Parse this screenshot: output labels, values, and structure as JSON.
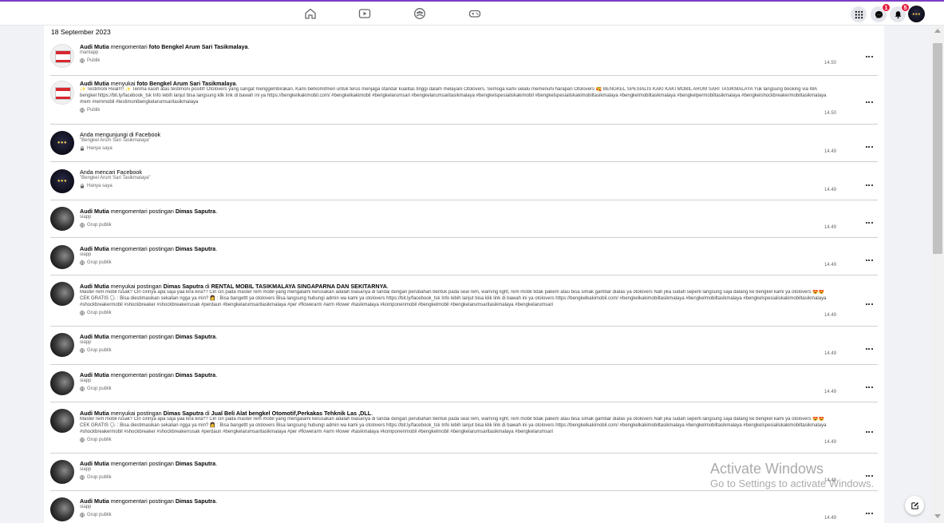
{
  "topbar": {
    "nav_icons": [
      "home-icon",
      "watch-icon",
      "groups-icon",
      "gaming-icon"
    ],
    "right_icons": [
      "menu-grid-icon",
      "messenger-icon",
      "notifications-icon",
      "profile-avatar"
    ],
    "messenger_badge": "1",
    "notifications_badge": "5",
    "accent_color": "#7b3fc4",
    "badge_color": "#e41e3f"
  },
  "log": {
    "date_heading": "18 September 2023",
    "entries": [
      {
        "actor": "Audi Mutia",
        "action": " mengomentari ",
        "target": "foto Bengkel Arum Sari Tasikmalaya",
        "suffix": ".",
        "detail": "mantapp",
        "privacy": "Publik",
        "privacy_icon": "globe-icon",
        "time": "14.50",
        "thumb": "bengkel"
      },
      {
        "actor": "Audi Mutia",
        "action": " menyukai ",
        "target": "foto Bengkel Arum Sari Tasikmalaya",
        "suffix": ".",
        "detail": "✨ Testimoni Real!!!! ✨ Terima kasih atas testimoni positif! Otolovers yang sangat menggembirakan. Kami berkomitmen untuk terus menjaga standar kualitas tinggi dalam melayani Otolovers. Semoga kami selalu memenuhi harapan Otolovers 🥰 BENGKEL SPESIALIS KAKI KAKI MOBIL ARUM SARI TASIKMALAYA Yuk langsung booking via WA bengkel https://bit.ly/facebook_tsk Info lebih lanjut bisa langsung klik link di bawah ini ya https://bengkelkakimobil.com/ #bengkelkakimobil #bengkelarumsari #bengkelarumsaritasikmalaya #bengkelspesialiskakimobil #bengkelspesialiskakimobiltasikmalaya #bengkelmobiltasikmalaya #bengkelpermobiltasikmalaya #bengkelshockbreakermobiltasikmalaya #rem #remmobil #testimonibengkelarumsaritasikmalaya",
        "privacy": "Publik",
        "privacy_icon": "globe-icon",
        "time": "14.50",
        "thumb": "bengkel"
      },
      {
        "actor": "",
        "action": "Anda mengunjungi di Facebook",
        "target": "",
        "suffix": "",
        "detail": "\"Bengkel Arum Sari Tasikmalaya\"",
        "privacy": "Hanya saya",
        "privacy_icon": "lock-icon",
        "time": "14.49",
        "thumb": "dark"
      },
      {
        "actor": "",
        "action": "Anda mencari Facebook",
        "target": "",
        "suffix": "",
        "detail": "\"Bengkel Arum Sari Tasikmalaya\"",
        "privacy": "Hanya saya",
        "privacy_icon": "lock-icon",
        "time": "14.49",
        "thumb": "dark"
      },
      {
        "actor": "Audi Mutia",
        "action": " mengomentari postingan ",
        "target": "Dimas Saputra",
        "suffix": ".",
        "detail": "siapp",
        "privacy": "Grup publik",
        "privacy_icon": "globe-icon",
        "time": "14.49",
        "thumb": "gray"
      },
      {
        "actor": "Audi Mutia",
        "action": " mengomentari postingan ",
        "target": "Dimas Saputra",
        "suffix": ".",
        "detail": "siapp",
        "privacy": "Grup publik",
        "privacy_icon": "globe-icon",
        "time": "14.49",
        "thumb": "gray"
      },
      {
        "actor": "Audi Mutia",
        "action": " menyukai postingan ",
        "target": "Dimas Saputra",
        "middle": " di ",
        "target2": "RENTAL MOBIL TASIKMALAYA SINGAPARNA DAN SEKITARNYA",
        "suffix": ".",
        "detail": "Master rem mobil rusak? Ciri cirinya apa saja yaa kira kira?? Ciri ciri pada master rem mobil yang mengalami kerusakan adalah biasanya di tandai dengan perubahan bentuk pada seal rem, warning light, rem mobil tidak pakem atau bisa simak gambar diatas ya otolovers Nah jika sudah seperti langsung saja datang ke bengkel kami ya otolovers 😍😍 CEK GRATIS 🗣 : Bisa diestimasikan sekalian ngga ya min? 👩 : Bisa bangettt ya otolovers Bisa langsung hubungi admin wa kami ya otolovers https://bit.ly/facebook_tsk Info lebih lanjut bisa klik link di bawah ini ya otolovers https://bengkelkakimobil.com/ #bengkelkakimobiltasikmalaya #bengkelmobiltasikmalaya #bengkelspesialiskakimobiltasikmalaya #shockbreakermobil #shockbreaker #shockbreakerrusak #perdaun #bengkelarumsaritasikmalaya #per #flowerarm #arm #lower #tasikmalaya #komponenmobil #bengkelmobil #bengkelarumsaritasikmalaya #bengkelarumsari",
        "privacy": "Grup publik",
        "privacy_icon": "globe-icon",
        "time": "14.49",
        "thumb": "gray"
      },
      {
        "actor": "Audi Mutia",
        "action": " mengomentari postingan ",
        "target": "Dimas Saputra",
        "suffix": ".",
        "detail": "siapp",
        "privacy": "Grup publik",
        "privacy_icon": "globe-icon",
        "time": "14.49",
        "thumb": "gray"
      },
      {
        "actor": "Audi Mutia",
        "action": " mengomentari postingan ",
        "target": "Dimas Saputra",
        "suffix": ".",
        "detail": "siapp",
        "privacy": "Grup publik",
        "privacy_icon": "globe-icon",
        "time": "14.49",
        "thumb": "gray"
      },
      {
        "actor": "Audi Mutia",
        "action": " menyukai postingan ",
        "target": "Dimas Saputra",
        "middle": " di ",
        "target2": "Jual Beli Alat bengkel Otomotif,Perkakas Tehknik Las ,DLL",
        "suffix": ".",
        "detail": "Master rem mobil rusak? Ciri cirinya apa saja yaa kira kira?? Ciri ciri pada master rem mobil yang mengalami kerusakan adalah biasanya di tandai dengan perubahan bentuk pada seal rem, warning light, rem mobil tidak pakem atau bisa simak gambar diatas ya otolovers Nah jika sudah seperti langsung saja datang ke bengkel kami ya otolovers 😍😍 CEK GRATIS 🗣 : Bisa diestimasikan sekalian ngga ya min? 👩 : Bisa bangettt ya otolovers Bisa langsung hubungi admin wa kami ya otolovers https://bit.ly/facebook_tsk Info lebih lanjut bisa klik link di bawah ini ya otolovers https://bengkelkakimobil.com/ #bengkelkakimobiltasikmalaya #bengkelmobiltasikmalaya #bengkelspesialiskakimobiltasikmalaya #shockbreakermobil #shockbreaker #shockbreakerrusak #perdaun #bengkelarumsaritasikmalaya #per #flowerarm #arm #lower #tasikmalaya #komponenmobil #bengkelmobil #bengkelarumsaritasikmalaya #bengkelarumsari",
        "privacy": "Grup publik",
        "privacy_icon": "globe-icon",
        "time": "14.49",
        "thumb": "gray"
      },
      {
        "actor": "Audi Mutia",
        "action": " mengomentari postingan ",
        "target": "Dimas Saputra",
        "suffix": ".",
        "detail": "siapp",
        "privacy": "Grup publik",
        "privacy_icon": "globe-icon",
        "time": "14.49",
        "thumb": "gray"
      },
      {
        "actor": "Audi Mutia",
        "action": " mengomentari postingan ",
        "target": "Dimas Saputra",
        "suffix": ".",
        "detail": "siapp",
        "privacy": "Grup publik",
        "privacy_icon": "globe-icon",
        "time": "14.49",
        "thumb": "gray"
      }
    ]
  },
  "watermark": {
    "title": "Activate Windows",
    "subtitle": "Go to Settings to activate Windows."
  },
  "compose_icon": "edit-icon"
}
